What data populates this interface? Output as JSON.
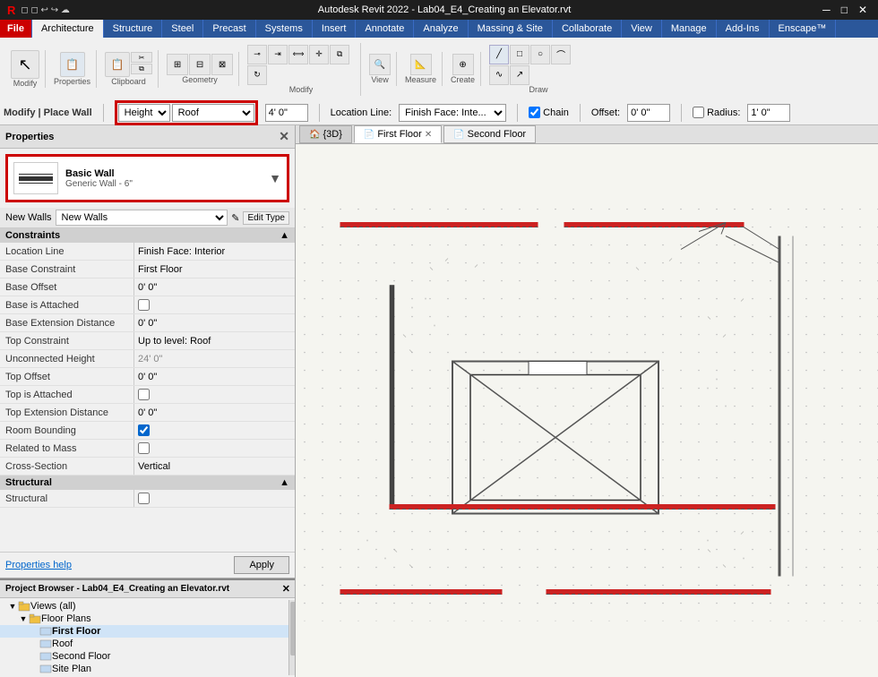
{
  "title_bar": {
    "title": "Autodesk Revit 2022 - Lab04_E4_Creating an Elevator.rvt"
  },
  "ribbon": {
    "tabs": [
      "R",
      "File",
      "Architecture",
      "Structure",
      "Steel",
      "Precast",
      "Systems",
      "Insert",
      "Annotate",
      "Analyze",
      "Massing & Site",
      "Collaborate",
      "View",
      "Manage",
      "Add-Ins",
      "Enscape™"
    ],
    "active_tab": "Architecture",
    "groups": [
      "Modify",
      "Clipboard",
      "Geometry",
      "Modify",
      "View",
      "Measure",
      "Create",
      "Draw"
    ]
  },
  "command_bar": {
    "modify_place_wall": "Modify | Place Wall",
    "height_label": "Height",
    "height_value": "Height",
    "roof_value": "Roof",
    "dimension_value": "4' 0\"",
    "location_line_label": "Location Line:",
    "location_line_value": "Finish Face: Inte...",
    "chain_label": "Chain",
    "chain_checked": true,
    "offset_label": "Offset:",
    "offset_value": "0' 0\"",
    "radius_label": "Radius:",
    "radius_value": "1' 0\"",
    "radius_checked": false
  },
  "properties_panel": {
    "header": "Properties",
    "wall_type": {
      "name": "Basic Wall",
      "subtype": "Generic Wall - 6\""
    },
    "new_walls_label": "New Walls",
    "edit_type_label": "Edit Type",
    "sections": [
      {
        "name": "Constraints",
        "rows": [
          {
            "label": "Location Line",
            "value": "Finish Face: Interior",
            "type": "text"
          },
          {
            "label": "Base Constraint",
            "value": "First Floor",
            "type": "text"
          },
          {
            "label": "Base Offset",
            "value": "0' 0\"",
            "type": "text"
          },
          {
            "label": "Base is Attached",
            "value": "",
            "type": "checkbox",
            "checked": false
          },
          {
            "label": "Base Extension Distance",
            "value": "0' 0\"",
            "type": "text"
          },
          {
            "label": "Top Constraint",
            "value": "Up to level: Roof",
            "type": "text"
          },
          {
            "label": "Unconnected Height",
            "value": "24' 0\"",
            "type": "text"
          },
          {
            "label": "Top Offset",
            "value": "0' 0\"",
            "type": "text"
          },
          {
            "label": "Top is Attached",
            "value": "",
            "type": "checkbox",
            "checked": false
          },
          {
            "label": "Top Extension Distance",
            "value": "0' 0\"",
            "type": "text"
          },
          {
            "label": "Room Bounding",
            "value": "",
            "type": "checkbox",
            "checked": true
          },
          {
            "label": "Related to Mass",
            "value": "",
            "type": "checkbox",
            "checked": false
          },
          {
            "label": "Cross-Section",
            "value": "Vertical",
            "type": "text"
          }
        ]
      },
      {
        "name": "Structural",
        "rows": [
          {
            "label": "Structural",
            "value": "",
            "type": "checkbox",
            "checked": false
          }
        ]
      }
    ],
    "help_link": "Properties help",
    "apply_button": "Apply"
  },
  "tabs": [
    {
      "label": "{3D}",
      "type": "3d",
      "closable": false
    },
    {
      "label": "First Floor",
      "type": "plan",
      "active": true,
      "closable": true
    },
    {
      "label": "Second Floor",
      "type": "plan",
      "active": false,
      "closable": false
    }
  ],
  "project_browser": {
    "title": "Project Browser - Lab04_E4_Creating an Elevator.rvt",
    "tree": [
      {
        "label": "Views (all)",
        "level": 0,
        "expanded": true,
        "type": "folder"
      },
      {
        "label": "Floor Plans",
        "level": 1,
        "expanded": true,
        "type": "folder"
      },
      {
        "label": "First Floor",
        "level": 2,
        "bold": true,
        "type": "view"
      },
      {
        "label": "Roof",
        "level": 2,
        "bold": false,
        "type": "view"
      },
      {
        "label": "Second Floor",
        "level": 2,
        "bold": false,
        "type": "view"
      },
      {
        "label": "Site Plan",
        "level": 2,
        "bold": false,
        "type": "view"
      }
    ]
  }
}
